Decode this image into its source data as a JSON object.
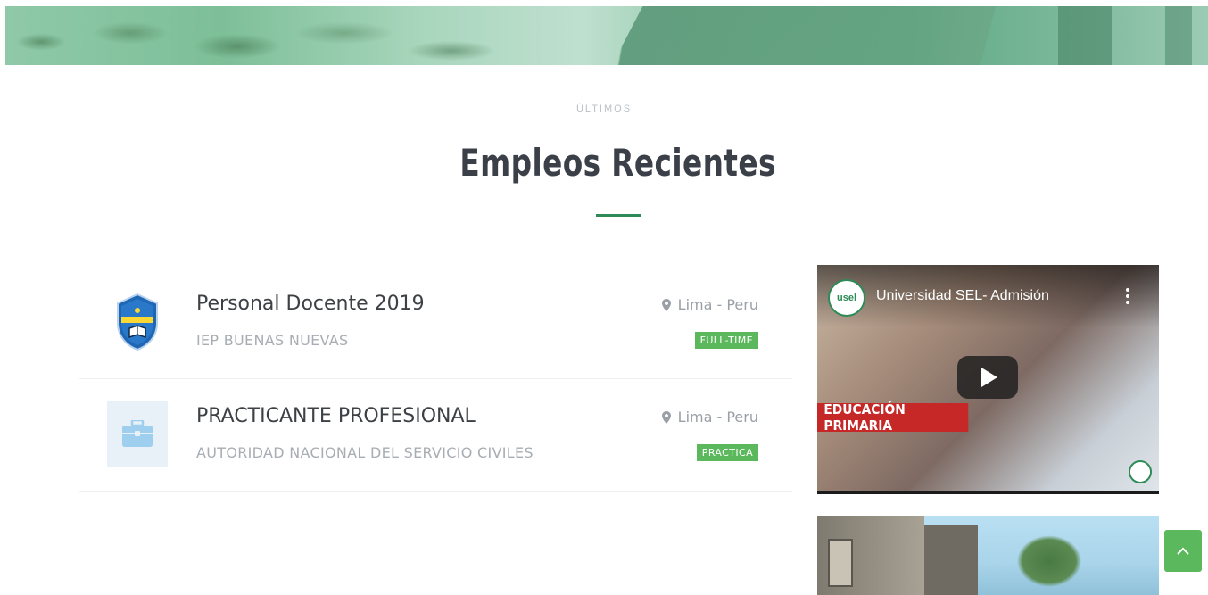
{
  "section": {
    "subtitle": "ÚLTIMOS",
    "title": "Empleos Recientes"
  },
  "jobs": [
    {
      "title": "Personal Docente 2019",
      "company": "IEP BUENAS NUEVAS",
      "location": "Lima - Peru",
      "type": "FULL-TIME",
      "logo_icon": "school-shield-icon"
    },
    {
      "title": "PRACTICANTE PROFESIONAL",
      "company": "AUTORIDAD NACIONAL DEL SERVICIO CIVILES",
      "location": "Lima - Peru",
      "type": "PRACTICA",
      "logo_icon": "briefcase-icon"
    }
  ],
  "video": {
    "title": "Universidad SEL- Admisión",
    "channel": "usel",
    "caption": "EDUCACIÓN PRIMARIA"
  },
  "colors": {
    "accent": "#2e8b57",
    "badge": "#5cb85c",
    "caption_red": "#c62828"
  }
}
